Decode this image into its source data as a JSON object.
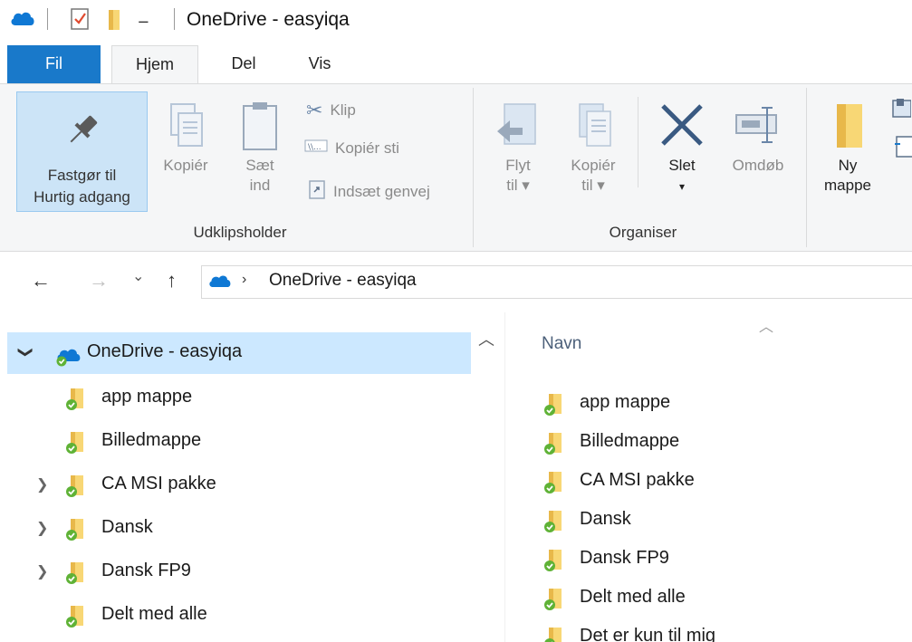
{
  "titlebar": {
    "title": "OneDrive - easyiqa"
  },
  "tabs": [
    {
      "label": "Fil"
    },
    {
      "label": "Hjem"
    },
    {
      "label": "Del"
    },
    {
      "label": "Vis"
    }
  ],
  "ribbon": {
    "pin": {
      "line1": "Fastgør til",
      "line2": "Hurtig adgang"
    },
    "copy": "Kopiér",
    "paste": {
      "line1": "Sæt",
      "line2": "ind"
    },
    "cut": "Klip",
    "copy_path": "Kopiér sti",
    "paste_shortcut": "Indsæt genvej",
    "group_clipboard": "Udklipsholder",
    "move_to": {
      "line1": "Flyt",
      "line2": "til ▾"
    },
    "copy_to": {
      "line1": "Kopiér",
      "line2": "til ▾"
    },
    "delete": {
      "line1": "Slet",
      "line2": "▾"
    },
    "rename": "Omdøb",
    "group_organize": "Organiser",
    "new_folder": {
      "line1": "Ny",
      "line2": "mappe"
    }
  },
  "address": {
    "back": "←",
    "forward": "→",
    "recent": "⌄",
    "up": "↑",
    "separator": "›",
    "path": "OneDrive - easyiqa"
  },
  "navpane": {
    "root": {
      "label": "OneDrive - easyiqa",
      "chevron": "❯"
    },
    "items": [
      {
        "label": "app mappe",
        "chevron": ""
      },
      {
        "label": "Billedmappe",
        "chevron": ""
      },
      {
        "label": "CA MSI pakke",
        "chevron": "❯"
      },
      {
        "label": "Dansk",
        "chevron": "❯"
      },
      {
        "label": "Dansk FP9",
        "chevron": "❯"
      },
      {
        "label": "Delt med alle",
        "chevron": ""
      }
    ]
  },
  "filelist": {
    "column_name": "Navn",
    "sort_indicator": "︿",
    "items": [
      {
        "label": "app mappe"
      },
      {
        "label": "Billedmappe"
      },
      {
        "label": "CA MSI pakke"
      },
      {
        "label": "Dansk"
      },
      {
        "label": "Dansk FP9"
      },
      {
        "label": "Delt med alle"
      },
      {
        "label": "Det er kun til mig"
      }
    ]
  },
  "scrollbar": {
    "up_arrow": "︿"
  },
  "colors": {
    "accent": "#1979ca",
    "selection": "#cce8ff",
    "ribbon_bg": "#f5f6f7",
    "folder": "#f8d775",
    "sync_check": "#5fb236"
  }
}
